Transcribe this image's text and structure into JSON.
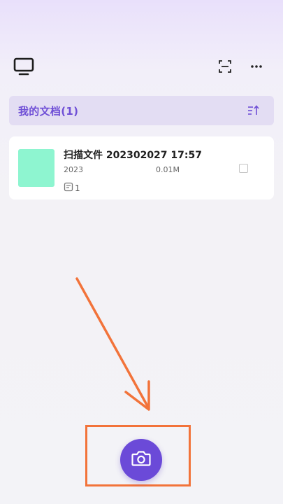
{
  "header": {
    "left_icon": "monitor-icon",
    "right_icons": [
      "scan-icon",
      "more-icon"
    ]
  },
  "section": {
    "title": "我的文档(1)",
    "sort_icon": "sort-icon"
  },
  "documents": [
    {
      "name": "扫描文件 202302027 17:57",
      "date": "2023",
      "size": "0.01M",
      "page_count": "1"
    }
  ],
  "camera_button": {
    "icon": "camera-icon"
  },
  "colors": {
    "accent": "#6b4ad8",
    "annotation": "#f2733a",
    "thumbnail": "#8ef5d0"
  }
}
